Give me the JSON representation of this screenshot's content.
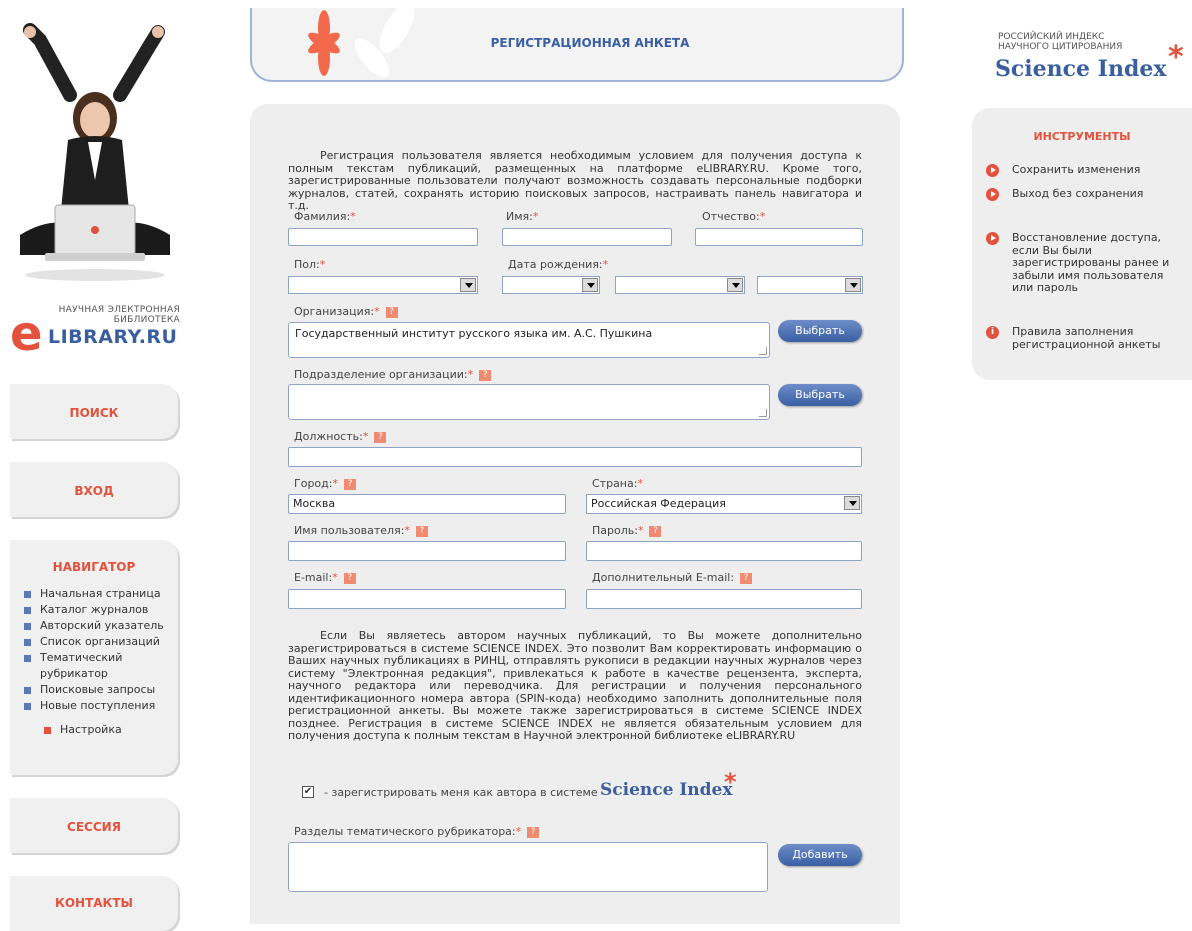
{
  "banner": {
    "title": "РЕГИСТРАЦИОННАЯ АНКЕТА"
  },
  "left": {
    "logo_small": "НАУЧНАЯ ЭЛЕКТРОННАЯ БИБЛИОТЕКА",
    "logo_text": "LIBRARY.RU",
    "search_btn": "ПОИСК",
    "login_btn": "ВХОД",
    "navigator_title": "НАВИГАТОР",
    "nav_items": [
      "Начальная страница",
      "Каталог журналов",
      "Авторский указатель",
      "Список организаций",
      "Тематический рубрикатор",
      "Поисковые запросы",
      "Новые поступления"
    ],
    "nav_settings": "Настройка",
    "session_btn": "СЕССИЯ",
    "contacts_btn": "КОНТАКТЫ"
  },
  "form": {
    "intro": "Регистрация пользователя является необходимым условием для получения доступа к полным текстам публикаций, размещенных на платформе eLIBRARY.RU. Кроме того, зарегистрированные пользователи получают возможность создавать персональные подборки журналов, статей, сохранять историю поисковых запросов, настраивать панель навигатора и т.д.",
    "lastname_label": "Фамилия:",
    "firstname_label": "Имя:",
    "middlename_label": "Отчество:",
    "gender_label": "Пол:",
    "birthdate_label": "Дата рождения:",
    "org_label": "Организация:",
    "org_value": "Государственный институт русского языка им. А.С. Пушкина",
    "choose_btn": "Выбрать",
    "dept_label": "Подразделение организации:",
    "position_label": "Должность:",
    "city_label": "Город:",
    "city_value": "Москва",
    "country_label": "Страна:",
    "country_value": "Российская Федерация",
    "username_label": "Имя пользователя:",
    "password_label": "Пароль:",
    "email_label": "E-mail:",
    "email2_label": "Дополнительный E-mail:",
    "author_text": "Если Вы являетесь автором научных публикаций, то Вы можете дополнительно зарегистрироваться в системе SCIENCE INDEX. Это позволит Вам корректировать информацию о Ваших научных публикациях в РИНЦ, отправлять рукописи в редакции научных журналов через систему \"Электронная редакция\", привлекаться к работе в качестве рецензента, эксперта, научного редактора или переводчика. Для регистрации и получения персонального идентификационного номера автора (SPIN-кода) необходимо заполнить дополнительные поля регистрационной анкеты. Вы можете также зарегистрироваться в системе SCIENCE INDEX позднее. Регистрация в системе SCIENCE INDEX не является обязательным условием для получения доступа к полным текстам в Научной электронной библиотеке eLIBRARY.RU",
    "register_check": "- зарегистрировать меня как автора в системе",
    "register_brand": "Science Index",
    "rubric_label": "Разделы тематического рубрикатора:",
    "add_btn": "Добавить",
    "required_mark": "*",
    "help_mark": "?"
  },
  "right": {
    "si_small": "РОССИЙСКИЙ ИНДЕКС НАУЧНОГО ЦИТИРОВАНИЯ",
    "si_big": "Science Index",
    "tools_title": "ИНСТРУМЕНТЫ",
    "tools": [
      "Сохранить изменения",
      "Выход без сохранения",
      "Восстановление доступа, если Вы были зарегистрированы ранее и забыли имя пользователя или пароль",
      "Правила заполнения регистрационной анкеты"
    ]
  },
  "colors": {
    "accent": "#e2523d",
    "brand_blue": "#3a5f9e",
    "panel": "#eeeeee"
  }
}
